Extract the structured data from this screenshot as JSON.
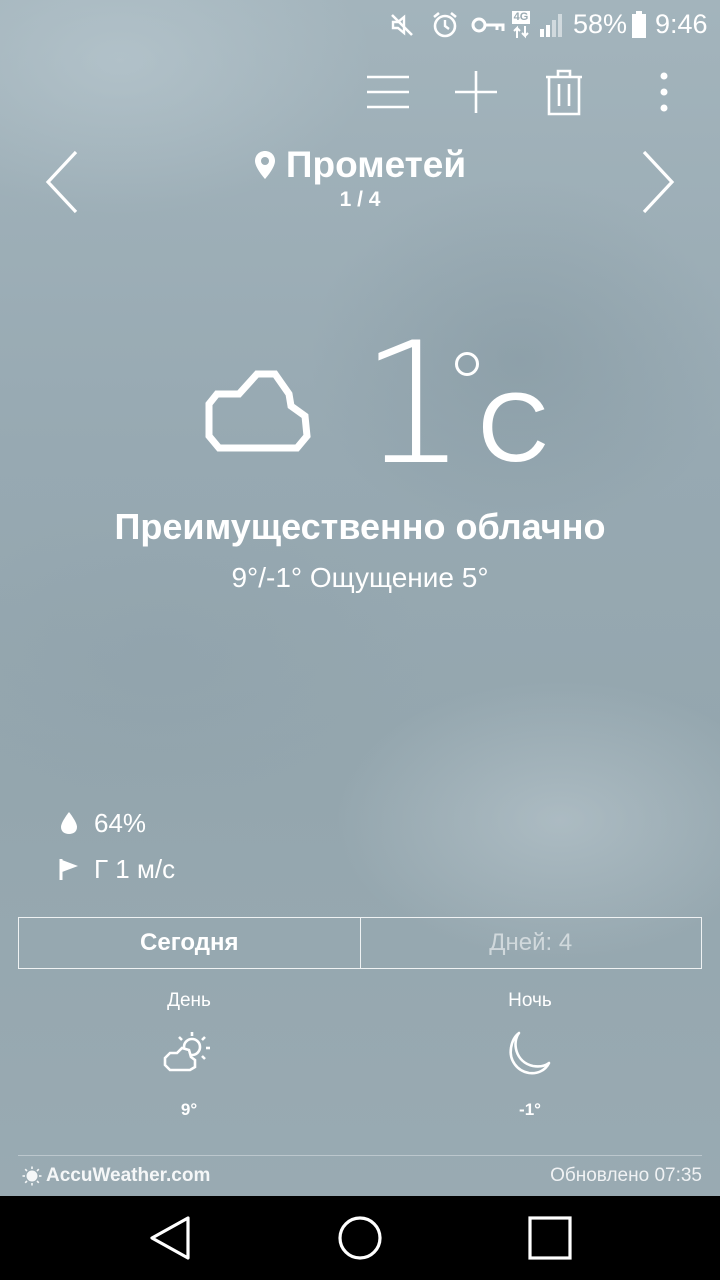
{
  "status_bar": {
    "battery_percent": "58%",
    "time": "9:46",
    "network_label": "4G",
    "icons": [
      "mute-icon",
      "alarm-icon",
      "vpn-key-icon",
      "4g-icon",
      "signal-icon",
      "battery-icon"
    ]
  },
  "toolbar": {
    "icons": [
      "menu-icon",
      "add-icon",
      "trash-icon",
      "more-vert-icon"
    ]
  },
  "location": {
    "name": "Прометей",
    "page_indicator": "1 / 4"
  },
  "current": {
    "temperature": "1",
    "unit": "C",
    "condition": "Преимущественно облачно",
    "minmax_feels": "9°/-1° Ощущение 5°",
    "humidity": "64%",
    "wind": "Г 1 м/с",
    "condition_icon": "cloud-icon"
  },
  "tabs": [
    {
      "label": "Сегодня",
      "active": true
    },
    {
      "label": "Дней: 4",
      "active": false
    }
  ],
  "forecast": {
    "day": {
      "label": "День",
      "temp": "9°",
      "icon": "partly-sunny-icon"
    },
    "night": {
      "label": "Ночь",
      "temp": "-1°",
      "icon": "moon-icon"
    }
  },
  "footer": {
    "brand": "AccuWeather.com",
    "updated": "Обновлено 07:35"
  },
  "colors": {
    "background": "#9aabb3",
    "navbar": "#000000",
    "text": "#ffffff"
  }
}
